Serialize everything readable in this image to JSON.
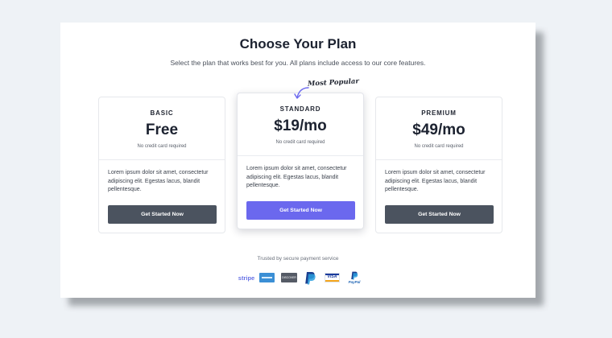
{
  "header": {
    "title": "Choose Your Plan",
    "subtitle": "Select the plan that works best for you. All plans include access to our core features."
  },
  "badge": {
    "label": "Most Popular"
  },
  "plans": [
    {
      "tier": "BASIC",
      "price": "Free",
      "note": "No credit card required",
      "description": "Lorem ipsum dolor sit amet, consectetur adipiscing elit. Egestas lacus, blandit pellentesque.",
      "button": "Get Started Now"
    },
    {
      "tier": "STANDARD",
      "price": "$19/mo",
      "note": "No credit card required",
      "description": "Lorem ipsum dolor sit amet, consectetur adipiscing elit. Egestas lacus, blandit pellentesque.",
      "button": "Get Started Now"
    },
    {
      "tier": "PREMIUM",
      "price": "$49/mo",
      "note": "No credit card required",
      "description": "Lorem ipsum dolor sit amet, consectetur adipiscing elit. Egestas lacus, blandit pellentesque.",
      "button": "Get Started Now"
    }
  ],
  "footer": {
    "trusted": "Trusted by secure payment service",
    "logos": {
      "stripe": "stripe",
      "discover": "DISCOVER",
      "visa": "VISA",
      "paypal": "PayPal"
    }
  },
  "colors": {
    "accent": "#6b68ee",
    "dark_button": "#4b535f",
    "background": "#eef2f6"
  },
  "icons": [
    "curved-arrow-icon",
    "amex-icon",
    "paypal-icon",
    "visa-icon",
    "discover-icon",
    "stripe-icon"
  ]
}
